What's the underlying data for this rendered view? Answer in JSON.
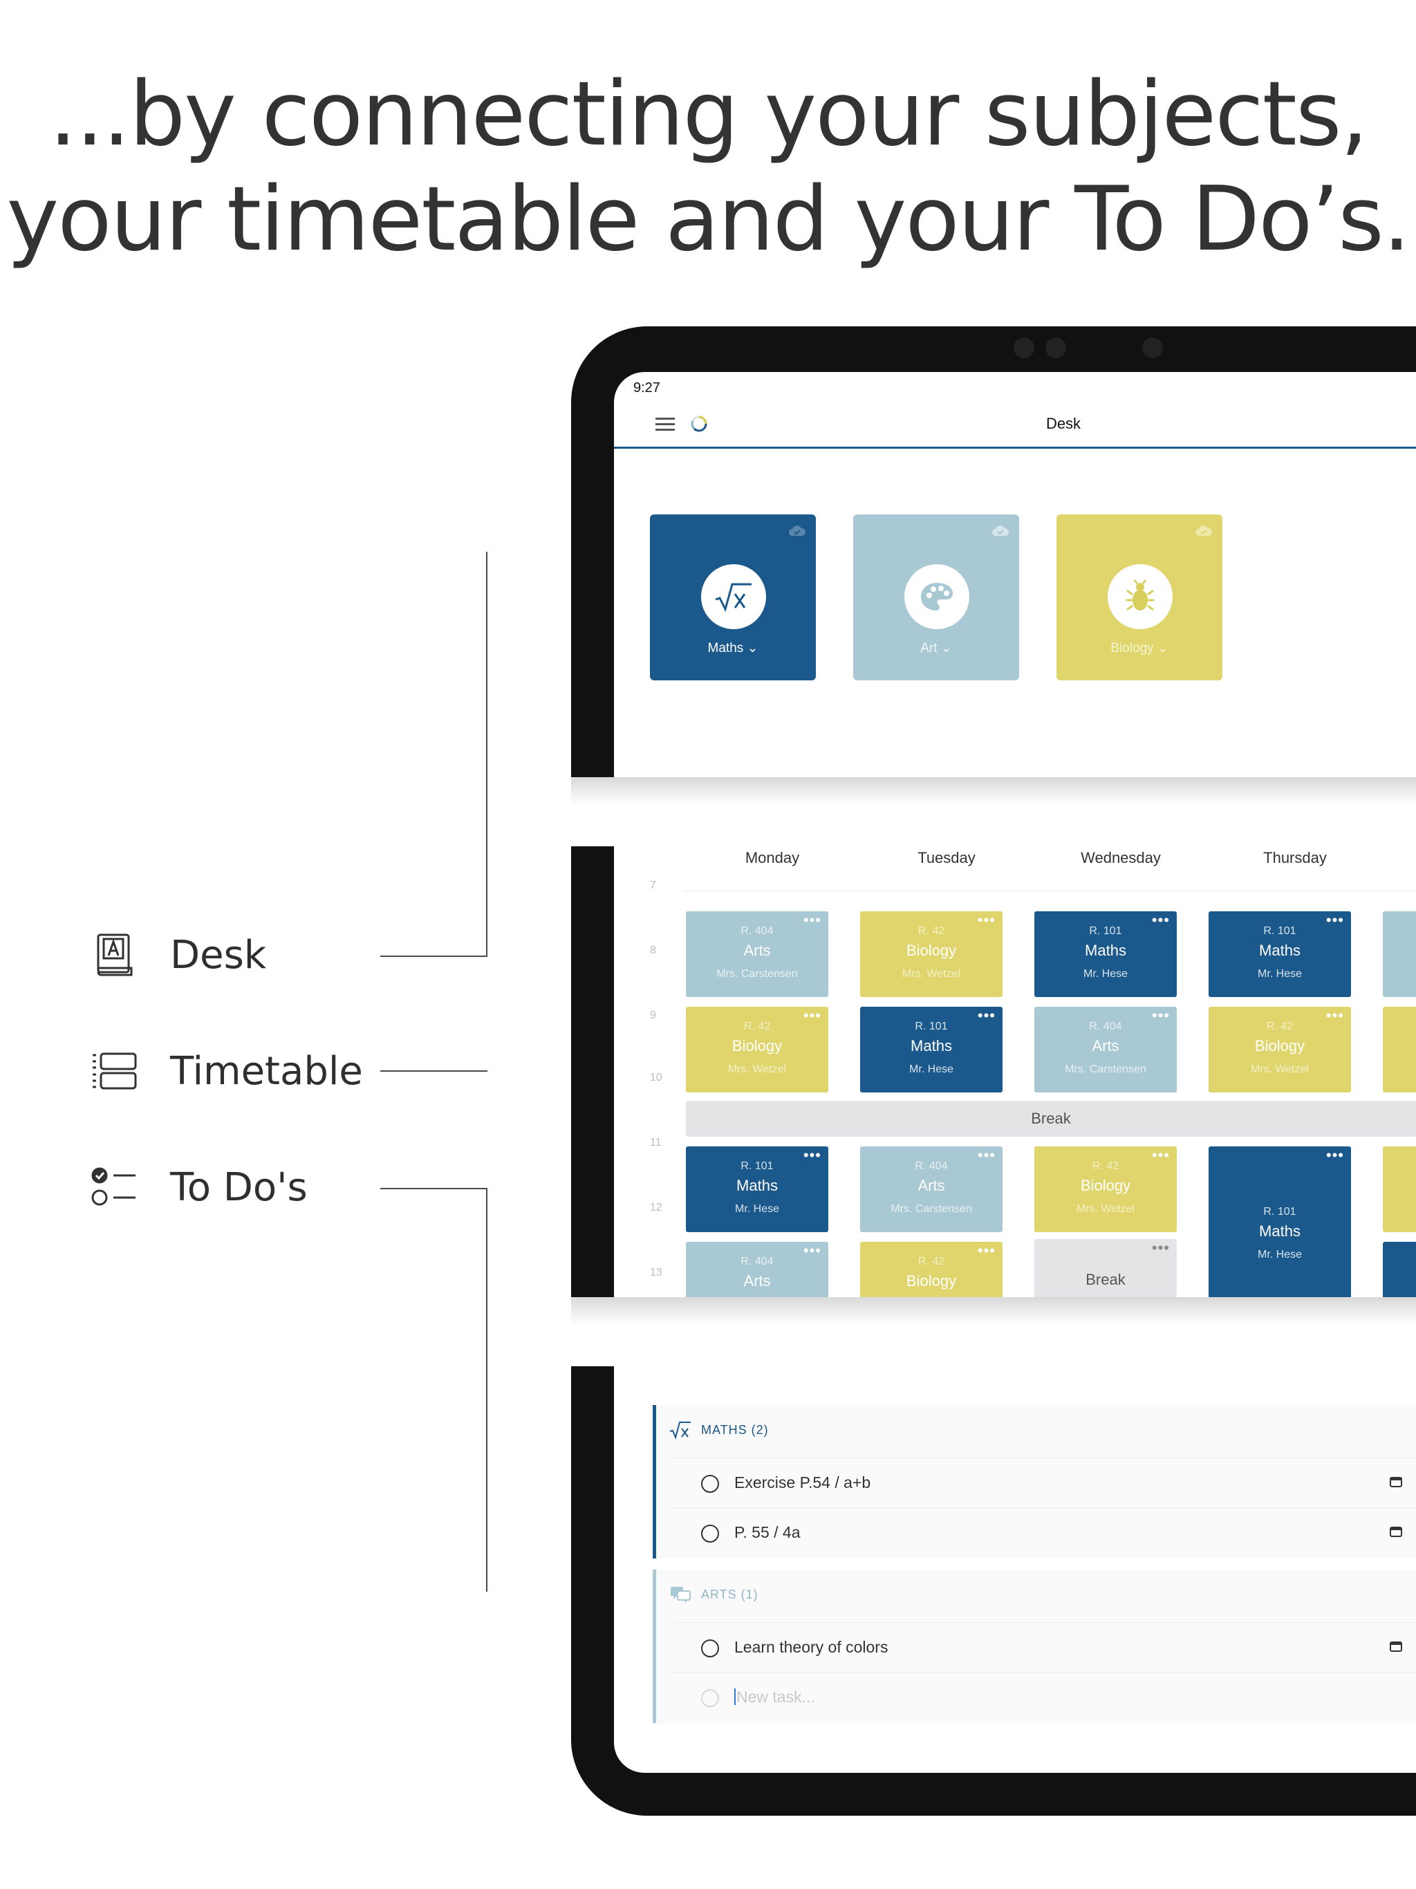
{
  "headline": {
    "line1": "...by connecting your subjects,",
    "line2": "your timetable and your To Do’s."
  },
  "features": [
    {
      "label": "Desk",
      "icon": "book-icon"
    },
    {
      "label": "Timetable",
      "icon": "timetable-icon"
    },
    {
      "label": "To Do's",
      "icon": "checklist-icon"
    }
  ],
  "desk": {
    "status_time": "9:27",
    "title": "Desk",
    "subjects": [
      {
        "name": "Maths",
        "icon": "square-root-icon",
        "color": "#1b588b"
      },
      {
        "name": "Art",
        "icon": "palette-icon",
        "color": "#a8c8d3"
      },
      {
        "name": "Biology",
        "icon": "bug-icon",
        "color": "#dfd56c"
      }
    ]
  },
  "timetable": {
    "days": [
      "Monday",
      "Tuesday",
      "Wednesday",
      "Thursday"
    ],
    "hours": [
      "7",
      "8",
      "9",
      "10",
      "11",
      "12",
      "13"
    ],
    "break_label": "Break",
    "lessons": [
      {
        "room": "R. 404",
        "subject": "Arts",
        "teacher": "Mrs. Carstensen"
      },
      {
        "room": "R. 42",
        "subject": "Biology",
        "teacher": "Mrs. Wetzel"
      },
      {
        "room": "R. 101",
        "subject": "Maths",
        "teacher": "Mr. Hese"
      },
      {
        "room": "R. 101",
        "subject": "Maths",
        "teacher": "Mr. Hese"
      },
      {
        "room": "R. 42",
        "subject": "Biology",
        "teacher": "Mrs. Wetzel"
      },
      {
        "room": "R. 101",
        "subject": "Maths",
        "teacher": "Mr. Hese"
      },
      {
        "room": "R. 404",
        "subject": "Arts",
        "teacher": "Mrs. Carstensen"
      },
      {
        "room": "R. 42",
        "subject": "Biology",
        "teacher": "Mrs. Wetzel"
      },
      {
        "room": "R. 101",
        "subject": "Maths",
        "teacher": "Mr. Hese"
      },
      {
        "room": "R. 404",
        "subject": "Arts",
        "teacher": "Mrs. Carstensen"
      },
      {
        "room": "R. 42",
        "subject": "Biology",
        "teacher": "Mrs. Wetzel"
      },
      {
        "room": "R. 101",
        "subject": "Maths",
        "teacher": "Mr. Hese"
      },
      {
        "room": "R. 404",
        "subject": "Arts",
        "teacher": ""
      },
      {
        "room": "R. 42",
        "subject": "Biology",
        "teacher": ""
      },
      {
        "room": "",
        "subject": "Break",
        "teacher": ""
      }
    ]
  },
  "todos": {
    "groups": [
      {
        "title": "MATHS (2)",
        "color": "#1b588b",
        "icon": "square-root-icon",
        "tasks": [
          "Exercise P.54 / a+b",
          "P. 55 / 4a"
        ]
      },
      {
        "title": "ARTS (1)",
        "color": "#a8c8d3",
        "icon": "chat-bubbles-icon",
        "tasks": [
          "Learn theory of colors"
        ]
      }
    ],
    "new_task_placeholder": "New task..."
  }
}
